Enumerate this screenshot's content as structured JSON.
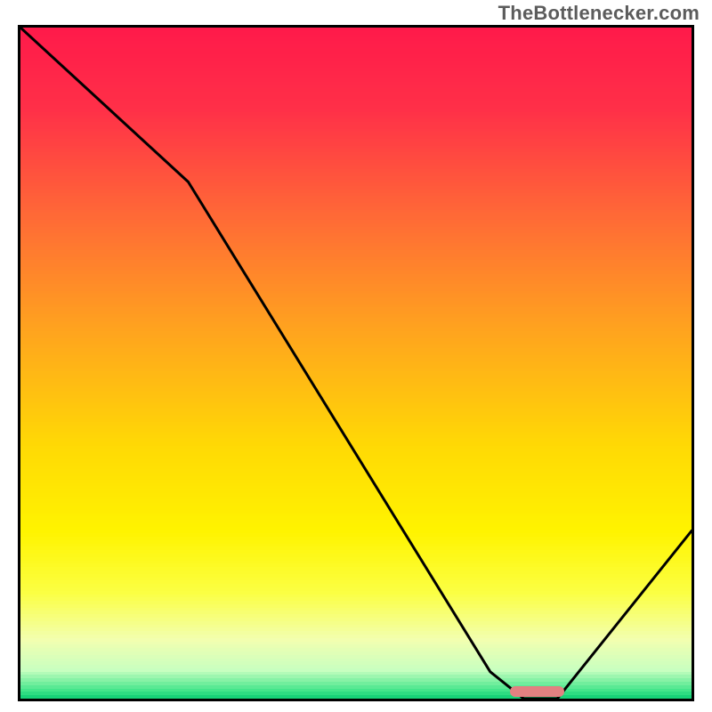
{
  "watermark": "TheBottlenecker.com",
  "chart_data": {
    "type": "line",
    "title": "",
    "xlabel": "",
    "ylabel": "",
    "xlim": [
      0,
      100
    ],
    "ylim": [
      0,
      100
    ],
    "x": [
      0,
      25,
      70,
      75,
      80,
      100
    ],
    "values": [
      100,
      77,
      4,
      0,
      0,
      25
    ],
    "marker": {
      "x_start": 73,
      "x_end": 81,
      "y": 0,
      "color": "#e28181"
    },
    "background_gradient": {
      "stops": [
        {
          "pos": 0.0,
          "color": "#ff1a4a"
        },
        {
          "pos": 0.12,
          "color": "#ff3048"
        },
        {
          "pos": 0.28,
          "color": "#ff6a36"
        },
        {
          "pos": 0.45,
          "color": "#ffa41e"
        },
        {
          "pos": 0.62,
          "color": "#ffd905"
        },
        {
          "pos": 0.75,
          "color": "#fff400"
        },
        {
          "pos": 0.84,
          "color": "#fbff44"
        },
        {
          "pos": 0.91,
          "color": "#f2ffb0"
        },
        {
          "pos": 0.955,
          "color": "#c8ffc0"
        },
        {
          "pos": 0.985,
          "color": "#44e58b"
        },
        {
          "pos": 1.0,
          "color": "#00c96f"
        }
      ]
    },
    "curve_style": {
      "stroke": "#000000",
      "width": 3
    }
  }
}
